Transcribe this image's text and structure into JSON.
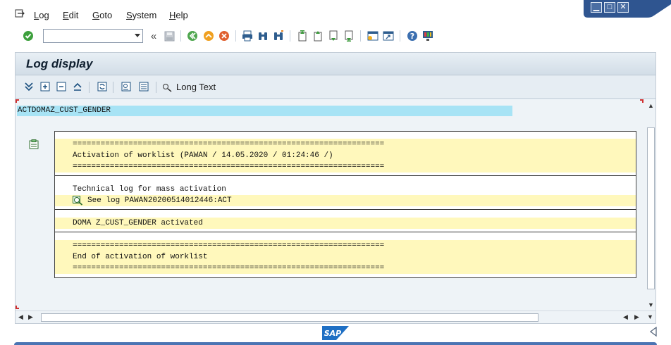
{
  "menu": {
    "items": [
      {
        "first": "L",
        "rest": "og"
      },
      {
        "first": "E",
        "rest": "dit"
      },
      {
        "first": "G",
        "rest": "oto"
      },
      {
        "first": "S",
        "rest": "ystem"
      },
      {
        "first": "H",
        "rest": "elp"
      }
    ]
  },
  "toolbar": {
    "command_value": "",
    "history_glyph": "«"
  },
  "window": {
    "minimize": "▁",
    "maximize": "□",
    "close": "✕"
  },
  "screen": {
    "title": "Log display",
    "long_text_label": "Long Text"
  },
  "object": {
    "name": "ACTDOMAZ_CUST_GENDER"
  },
  "log": {
    "separator": "===================================================================",
    "activation_header": "Activation of worklist (PAWAN / 14.05.2020 / 01:24:46 /)",
    "tech_log_title": "Technical log for mass activation",
    "see_log": "See log PAWAN20200514012446:ACT",
    "doma_activated": "DOMA Z_CUST_GENDER activated",
    "end_activation": "End of activation of worklist"
  },
  "colors": {
    "accent": "#4b74b3",
    "highlight_row": "#fff8bc",
    "object_highlight": "#a7e3f5",
    "frame_bg": "#dfe8ef"
  }
}
